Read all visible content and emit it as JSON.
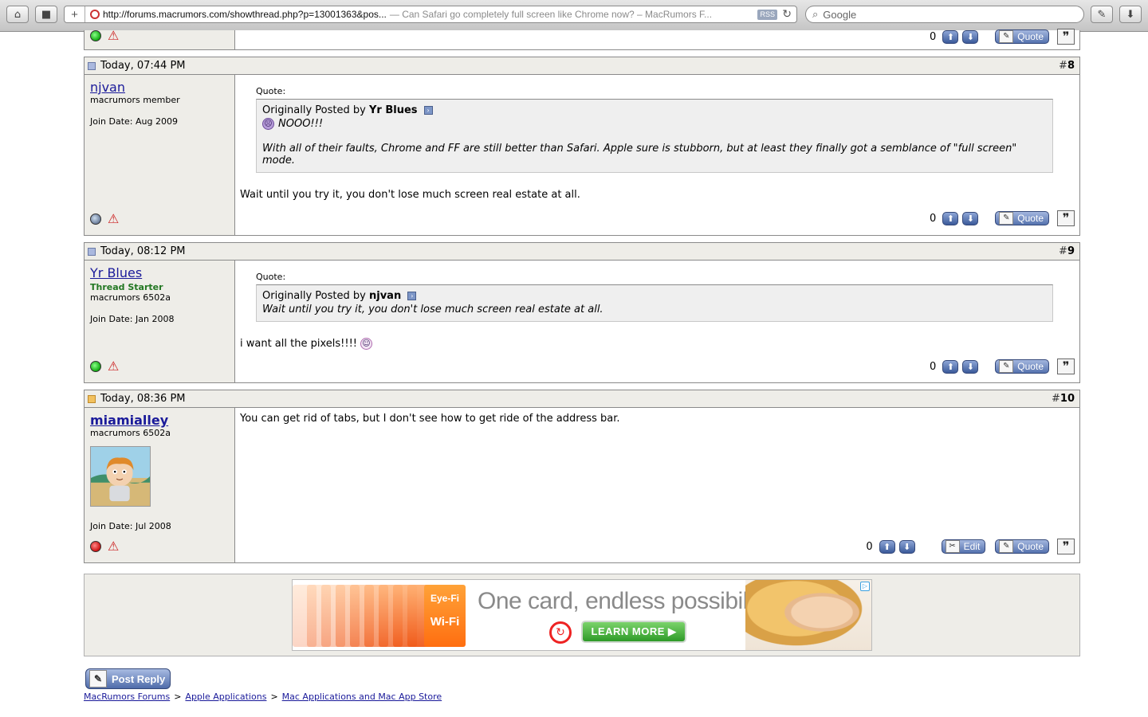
{
  "browser": {
    "url": "http://forums.macrumors.com/showthread.php?p=13001363&pos...",
    "page_title": "— Can Safari go completely full screen like Chrome now? – MacRumors F...",
    "rss_label": "RSS",
    "search_placeholder": "Google"
  },
  "posts": [
    {
      "date": "",
      "number_prefix": "",
      "score": "0",
      "quote_label": "Quote"
    },
    {
      "date": "Today, 07:44 PM",
      "number_prefix": "#",
      "number": "8",
      "username": "njvan",
      "user_title": "macrumors member",
      "join_date": "Join Date: Aug 2009",
      "quote_header": "Quote:",
      "quote_originally": "Originally Posted by",
      "quote_author": "Yr Blues",
      "quote_line1": "NOOO!!!",
      "quote_line2": "With all of their faults, Chrome and FF are still better than Safari. Apple sure is stubborn, but at least they finally got a semblance of \"full screen\" mode.",
      "message": "Wait until you try it, you don't lose much screen real estate at all.",
      "score": "0",
      "quote_label": "Quote"
    },
    {
      "date": "Today, 08:12 PM",
      "number_prefix": "#",
      "number": "9",
      "username": "Yr Blues",
      "user_status": "Thread Starter",
      "user_title": "macrumors 6502a",
      "join_date": "Join Date: Jan 2008",
      "quote_header": "Quote:",
      "quote_originally": "Originally Posted by",
      "quote_author": "njvan",
      "quote_line1": "Wait until you try it, you don't lose much screen real estate at all.",
      "message": "i want all the pixels!!!!",
      "score": "0",
      "quote_label": "Quote"
    },
    {
      "date": "Today, 08:36 PM",
      "number_prefix": "#",
      "number": "10",
      "username": "miamialley",
      "user_title": "macrumors 6502a",
      "join_date": "Join Date: Jul 2008",
      "message": "You can get rid of tabs, but I don't see how to get ride of the address bar.",
      "score": "0",
      "edit_label": "Edit",
      "quote_label": "Quote"
    }
  ],
  "ad": {
    "headline": "One card, endless possibilities.",
    "cta": "LEARN MORE ▶",
    "card_brand": "Eye-Fi",
    "card_label": "Wi-Fi"
  },
  "footer": {
    "post_reply": "Post Reply",
    "breadcrumb": [
      "MacRumors Forums",
      "Apple Applications",
      "Mac Applications and Mac App Store"
    ],
    "breadcrumb_sep": ">"
  }
}
